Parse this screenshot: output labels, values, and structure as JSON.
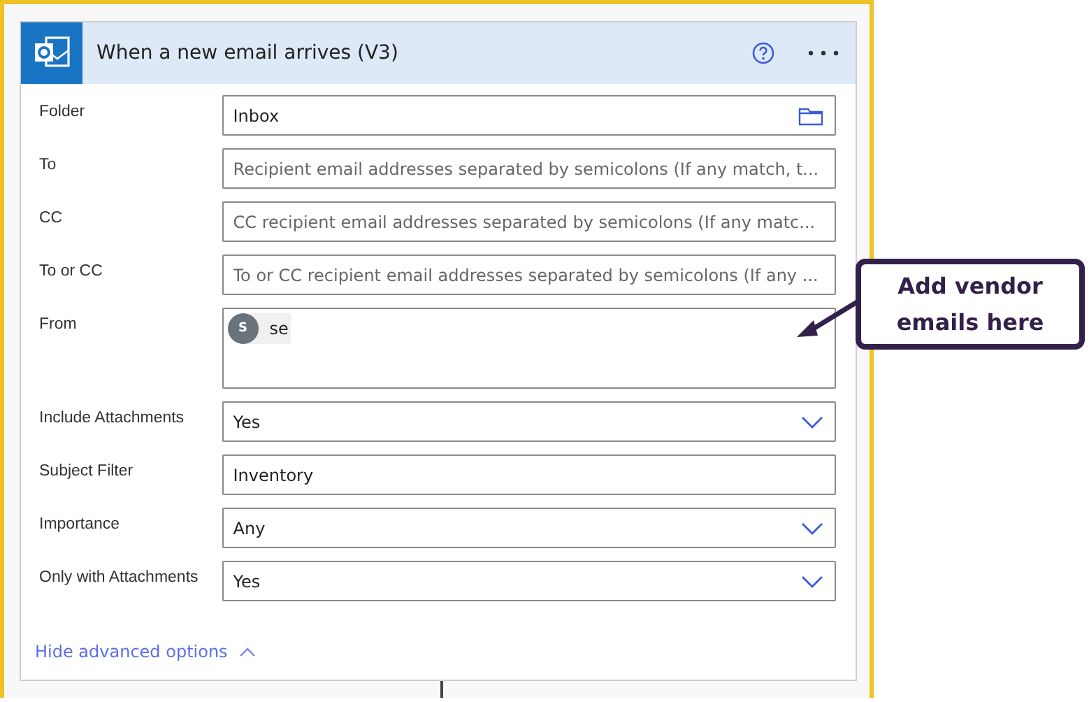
{
  "card": {
    "title": "When a new email arrives (V3)"
  },
  "fields": [
    {
      "label": "Folder",
      "kind": "folder",
      "value": "Inbox"
    },
    {
      "label": "To",
      "kind": "text",
      "placeholder": "Recipient email addresses separated by semicolons (If any match, t..."
    },
    {
      "label": "CC",
      "kind": "text",
      "placeholder": "CC recipient email addresses separated by semicolons (If any matc..."
    },
    {
      "label": "To or CC",
      "kind": "text",
      "placeholder": "To or CC recipient email addresses separated by semicolons (If any ..."
    },
    {
      "label": "From",
      "kind": "tokens",
      "tokens": [
        {
          "initial": "S",
          "text": "se"
        }
      ]
    },
    {
      "label": "Include Attachments",
      "kind": "dropdown",
      "value": "Yes"
    },
    {
      "label": "Subject Filter",
      "kind": "text",
      "value": "Inventory"
    },
    {
      "label": "Importance",
      "kind": "dropdown",
      "value": "Any"
    },
    {
      "label": "Only with Attachments",
      "kind": "dropdown",
      "value": "Yes"
    }
  ],
  "advanced_link": "Hide advanced options",
  "callout": "Add vendor emails here"
}
